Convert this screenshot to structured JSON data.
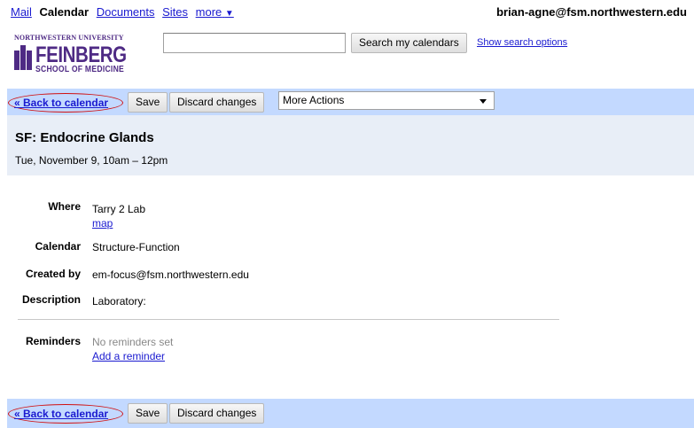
{
  "topnav": {
    "mail": "Mail",
    "calendar": "Calendar",
    "documents": "Documents",
    "sites": "Sites",
    "more": "more",
    "more_caret": "▼",
    "account": "brian-agne@fsm.northwestern.edu"
  },
  "logo": {
    "university": "NORTHWESTERN UNIVERSITY",
    "name": "FEINBERG",
    "school": "SCHOOL OF MEDICINE"
  },
  "search": {
    "value": "",
    "button": "Search my calendars",
    "options_link": "Show search options"
  },
  "actions": {
    "back": "« Back to calendar",
    "save": "Save",
    "discard": "Discard changes",
    "more_actions": "More Actions"
  },
  "event": {
    "title": "SF: Endocrine Glands",
    "when": "Tue, November 9, 10am – 12pm"
  },
  "details": {
    "where_label": "Where",
    "where_value": "Tarry 2 Lab",
    "map_link": "map",
    "calendar_label": "Calendar",
    "calendar_value": "Structure-Function",
    "created_label": "Created by",
    "created_value": "em-focus@fsm.northwestern.edu",
    "description_label": "Description",
    "description_value": "Laboratory:",
    "reminders_label": "Reminders",
    "reminders_value": "No reminders set",
    "add_reminder": "Add a reminder"
  },
  "colors": {
    "action_bar": "#c3d9ff",
    "event_header": "#e8eef7",
    "link": "#1a1ad0",
    "highlight_oval": "#d01010",
    "brand_purple": "#4e2a84"
  }
}
